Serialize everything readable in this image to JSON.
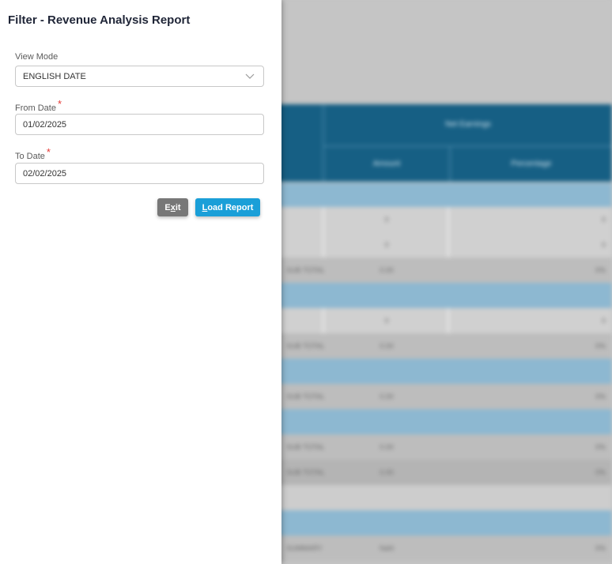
{
  "panel": {
    "title": "Filter - Revenue Analysis Report",
    "view_mode": {
      "label": "View Mode",
      "value": "ENGLISH DATE"
    },
    "from_date": {
      "label": "From Date",
      "required_mark": "*",
      "value": "01/02/2025"
    },
    "to_date": {
      "label": "To Date",
      "required_mark": "*",
      "value": "02/02/2025"
    },
    "buttons": {
      "exit": {
        "first": "E",
        "hotkey": "x",
        "rest": "it"
      },
      "load": {
        "hotkey": "L",
        "rest": "oad Report"
      }
    }
  },
  "background_report": {
    "header": {
      "group": "Net Earnings",
      "col_amount": "Amount",
      "col_percentage": "Percentage"
    },
    "rows": [
      {
        "kind": "section"
      },
      {
        "kind": "data",
        "name": "",
        "amount": "0",
        "pct": "0"
      },
      {
        "kind": "data",
        "name": "",
        "amount": "0",
        "pct": "0"
      },
      {
        "kind": "total",
        "name": "SUB TOTAL",
        "amount": "0.00",
        "pct": "0%"
      },
      {
        "kind": "section"
      },
      {
        "kind": "data",
        "name": "",
        "amount": "0",
        "pct": "0"
      },
      {
        "kind": "total",
        "name": "SUB TOTAL",
        "amount": "0.00",
        "pct": "0%"
      },
      {
        "kind": "section"
      },
      {
        "kind": "total",
        "name": "SUB TOTAL",
        "amount": "0.00",
        "pct": "0%"
      },
      {
        "kind": "section"
      },
      {
        "kind": "total",
        "name": "SUB TOTAL",
        "amount": "0.00",
        "pct": "0%"
      },
      {
        "kind": "grand",
        "name": "SUB TOTAL",
        "amount": "0.00",
        "pct": "0%"
      },
      {
        "kind": "blank"
      },
      {
        "kind": "section"
      },
      {
        "kind": "total",
        "name": "SUMMARY",
        "amount": "NaN",
        "pct": "0%"
      }
    ]
  },
  "colors": {
    "header_bg": "#165f84",
    "section_bg": "#8db8d1",
    "data_bg": "#d0d0d0",
    "total_bg": "#bdbdbd",
    "exit_button": "#777777",
    "load_button": "#1a9fd8"
  },
  "icons": {
    "view_mode_dropdown": "chevron-down-icon"
  }
}
